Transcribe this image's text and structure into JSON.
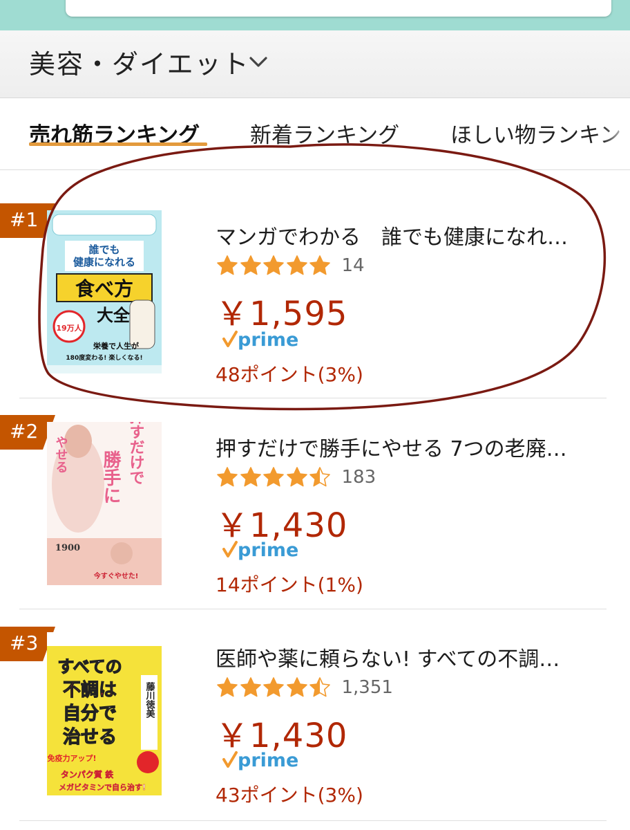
{
  "header": {
    "category": "美容・ダイエット"
  },
  "tabs": [
    {
      "label": "売れ筋ランキング",
      "active": true
    },
    {
      "label": "新着ランキング",
      "active": false
    },
    {
      "label": "ほしい物ランキン",
      "active": false
    }
  ],
  "items": [
    {
      "rank": "#1",
      "title": "マンガでわかる　誰でも健康になれ…",
      "rating": 5.0,
      "review_count": "14",
      "price": "￥1,595",
      "prime": "prime",
      "points": "48ポイント(3%)",
      "cover": {
        "line1": "誰でも",
        "line2": "健康になれる",
        "line3": "食べ方",
        "line4": "大全",
        "badge": "19万人",
        "sub": "栄養で人生が",
        "sub2": "180度変わる! 楽しくなる!"
      }
    },
    {
      "rank": "#2",
      "title": "押すだけで勝手にやせる 7つの老廃…",
      "rating": 4.5,
      "review_count": "183",
      "price": "￥1,430",
      "prime": "prime",
      "points": "14ポイント(1%)",
      "cover": {
        "line1": "押すだけで",
        "line2": "勝手に",
        "line3": "やせる",
        "badge": "1900",
        "sub": "今すぐやせた!"
      }
    },
    {
      "rank": "#3",
      "title": "医師や薬に頼らない! すべての不調…",
      "rating": 4.5,
      "review_count": "1,351",
      "price": "￥1,430",
      "prime": "prime",
      "points": "43ポイント(3%)",
      "cover": {
        "line1": "すべての",
        "line2": "不調は",
        "line3": "自分で",
        "line4": "治せる",
        "author": "藤川徳美",
        "sub": "免疫力アップ!",
        "sub2": "タンパク質 鉄",
        "sub3": "メガビタミンで自ら治す!"
      }
    }
  ],
  "colors": {
    "price": "#b12704",
    "star": "#f29a2e",
    "rank_badge": "#c45500",
    "tab_underline": "#e39a3c",
    "prime": "#3a9bd5",
    "annotation": "#7a1a12"
  }
}
